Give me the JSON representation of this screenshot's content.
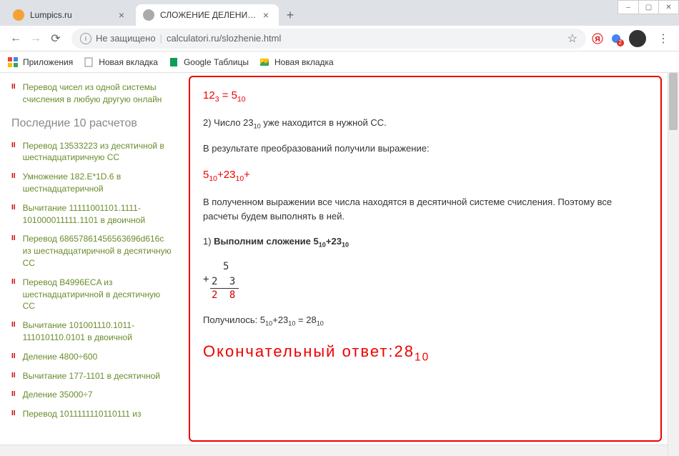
{
  "window": {
    "minimize": "–",
    "maximize": "▢",
    "close": "✕"
  },
  "tabs": [
    {
      "title": "Lumpics.ru",
      "favicon_color": "#f4a236",
      "active": false
    },
    {
      "title": "СЛОЖЕНИЕ ДЕЛЕНИЕ УМНОЖЕ",
      "favicon_color": "#888",
      "active": true
    }
  ],
  "newTab": "+",
  "nav": {
    "back": "←",
    "forward": "→",
    "reload": "⟳"
  },
  "address": {
    "info": "i",
    "security": "Не защищено",
    "url": "calculatori.ru/slozhenie.html"
  },
  "toolbar": {
    "star": "☆",
    "ext_badge": "2",
    "menu": "⋮"
  },
  "bookmarks": {
    "apps_icon_colors": [
      "#ea4335",
      "#4285f4",
      "#fbbc05",
      "#34a853"
    ],
    "items": [
      {
        "label": "Приложения",
        "icon": "apps"
      },
      {
        "label": "Новая вкладка",
        "icon": "doc"
      },
      {
        "label": "Google Таблицы",
        "icon": "sheets"
      },
      {
        "label": "Новая вкладка",
        "icon": "img"
      }
    ]
  },
  "sidebar": {
    "top_item": "Перевод чисел из одной системы счисления в любую другую онлайн",
    "heading": "Последние 10 расчетов",
    "items": [
      "Перевод 13533223 из десятичной в шестнадцатиричную СС",
      "Умножение 182.E*1D.6 в шестнадцатеричной",
      "Вычитание 11111001101.1111-101000011111.1101 в двоичной",
      "Перевод 68657861456563696d616c из шестнадцатиричной в десятичную СС",
      "Перевод B4996ECA из шестнадцатиричной в десятичную СС",
      "Вычитание 101001110.1011-111010110.0101 в двоичной",
      "Деление 4800÷600",
      "Вычитание 177-1101 в десятичной",
      "Деление 35000÷7",
      "Перевод 1011111110110111 из"
    ]
  },
  "main": {
    "expr1_num": "12",
    "expr1_sub1": "3",
    "expr1_eq": " = 5",
    "expr1_sub2": "10",
    "p1_a": "2) Число 23",
    "p1_sub": "10",
    "p1_b": " уже находится в нужной СС.",
    "p2": "В результате преобразований получили выражение:",
    "expr2_a": "5",
    "expr2_s1": "10",
    "expr2_b": "+23",
    "expr2_s2": "10",
    "expr2_c": "+",
    "p3": "В полученном выражении все числа находятся в десятичной системе счисления. Поэтому все расчеты будем выполнять в ней.",
    "p4_a": "1) ",
    "p4_b": "Выполним сложение 5",
    "p4_s1": "10",
    "p4_c": "+23",
    "p4_s2": "10",
    "math": {
      "r1": "5",
      "r2_op": "+",
      "r3": "2 3",
      "r4": "2 8"
    },
    "p5_a": "Получилось: 5",
    "p5_s1": "10",
    "p5_b": "+23",
    "p5_s2": "10",
    "p5_c": " = 28",
    "p5_s3": "10",
    "final_a": "Окончательный ответ:28",
    "final_sub": "10"
  }
}
